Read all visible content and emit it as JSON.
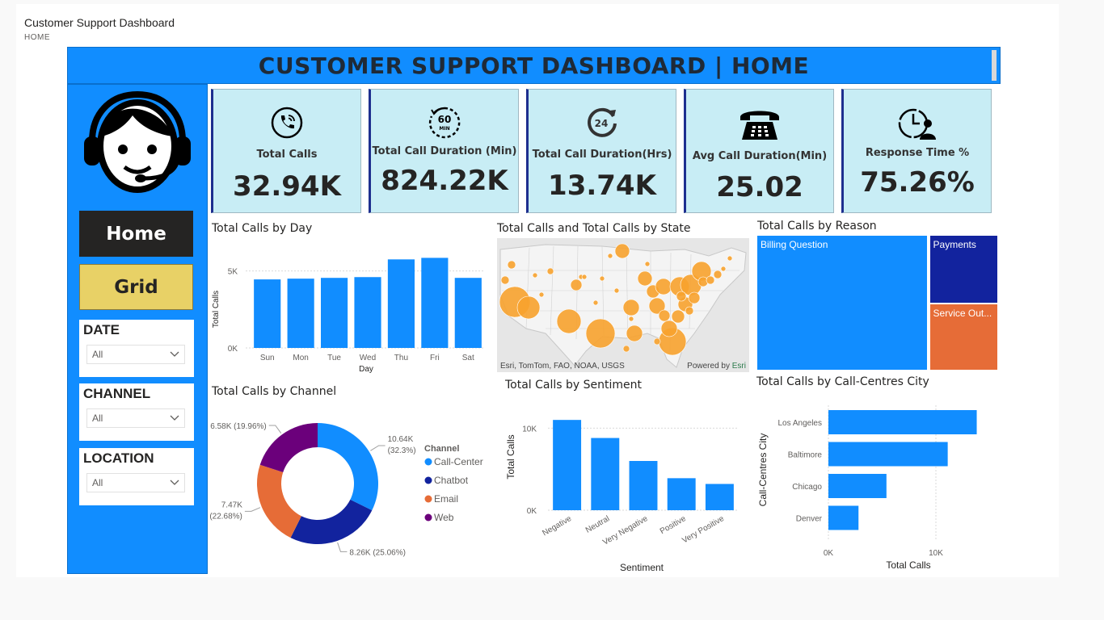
{
  "app": {
    "title": "Customer Support Dashboard",
    "breadcrumb": "HOME"
  },
  "header": {
    "title": "CUSTOMER SUPPORT DASHBOARD | HOME"
  },
  "sidebar": {
    "nav": [
      {
        "label": "Home"
      },
      {
        "label": "Grid"
      }
    ],
    "slicers": [
      {
        "title": "DATE",
        "value": "All"
      },
      {
        "title": "CHANNEL",
        "value": "All"
      },
      {
        "title": "LOCATION",
        "value": "All"
      }
    ]
  },
  "kpis": [
    {
      "label": "Total Calls",
      "value": "32.94K",
      "icon": "phone-call-icon"
    },
    {
      "label": "Total Call Duration (Min)",
      "value": "824.22K",
      "icon": "sixty-min-timer-icon"
    },
    {
      "label": "Total Call Duration(Hrs)",
      "value": "13.74K",
      "icon": "twenty-four-hours-icon"
    },
    {
      "label": "Avg Call Duration(Min)",
      "value": "25.02",
      "icon": "telephone-icon"
    },
    {
      "label": "Response Time %",
      "value": "75.26%",
      "icon": "clock-person-icon"
    }
  ],
  "visuals": {
    "calls_by_day": {
      "title": "Total Calls by Day"
    },
    "calls_by_state": {
      "title": "Total Calls and Total Calls by State",
      "credit_left": "Esri, TomTom, FAO, NOAA, USGS",
      "credit_right_prefix": "Powered by ",
      "credit_right_brand": "Esri"
    },
    "calls_by_reason": {
      "title": "Total Calls by Reason"
    },
    "calls_by_channel": {
      "title": "Total Calls by Channel",
      "legend_title": "Channel"
    },
    "calls_by_sentiment": {
      "title": "Total Calls by Sentiment"
    },
    "calls_by_city": {
      "title": "Total Calls by Call-Centres City"
    }
  },
  "colors": {
    "accent": "#118dff",
    "dark_blue": "#12239e",
    "orange": "#e66c37",
    "purple": "#6b007b",
    "kpi_bg": "#c8edf5",
    "map_bubble": "#f7a22e"
  },
  "chart_data": [
    {
      "id": "day",
      "type": "bar",
      "categories": [
        "Sun",
        "Mon",
        "Tue",
        "Wed",
        "Thu",
        "Fri",
        "Sat"
      ],
      "values": [
        4450,
        4500,
        4550,
        4600,
        5750,
        5850,
        4550
      ],
      "xlabel": "Day",
      "ylabel": "Total Calls",
      "yticks": [
        "0K",
        "5K"
      ],
      "ylim": [
        0,
        6500
      ]
    },
    {
      "id": "channel",
      "type": "pie",
      "categories": [
        "Call-Center",
        "Chatbot",
        "Email",
        "Web"
      ],
      "values": [
        10640,
        8260,
        7470,
        6580
      ],
      "labels": [
        [
          "10.64K",
          "(32.3%)"
        ],
        [
          "8.26K (25.06%)"
        ],
        [
          "7.47K",
          "(22.68%)"
        ],
        [
          "6.58K (19.96%)"
        ]
      ],
      "colors": [
        "#118dff",
        "#12239e",
        "#e66c37",
        "#6b007b"
      ]
    },
    {
      "id": "sentiment",
      "type": "bar",
      "categories": [
        "Negative",
        "Neutral",
        "Very Negative",
        "Positive",
        "Very Positive"
      ],
      "values": [
        11000,
        8800,
        6000,
        3900,
        3200
      ],
      "xlabel": "Sentiment",
      "ylabel": "Total Calls",
      "yticks": [
        "0K",
        "10K"
      ],
      "ylim": [
        0,
        12000
      ]
    },
    {
      "id": "city",
      "type": "bar",
      "orientation": "horizontal",
      "categories": [
        "Los Angeles",
        "Baltimore",
        "Chicago",
        "Denver"
      ],
      "values": [
        13800,
        11100,
        5400,
        2800
      ],
      "xlabel": "Total Calls",
      "ylabel": "Call-Centres City",
      "xticks": [
        "0K",
        "10K"
      ],
      "xlim": [
        0,
        15000
      ]
    },
    {
      "id": "reason",
      "type": "treemap",
      "categories": [
        "Billing Question",
        "Payments",
        "Service Out..."
      ],
      "values": [
        23460,
        4750,
        4730
      ],
      "colors": [
        "#118dff",
        "#12239e",
        "#e66c37"
      ]
    }
  ]
}
